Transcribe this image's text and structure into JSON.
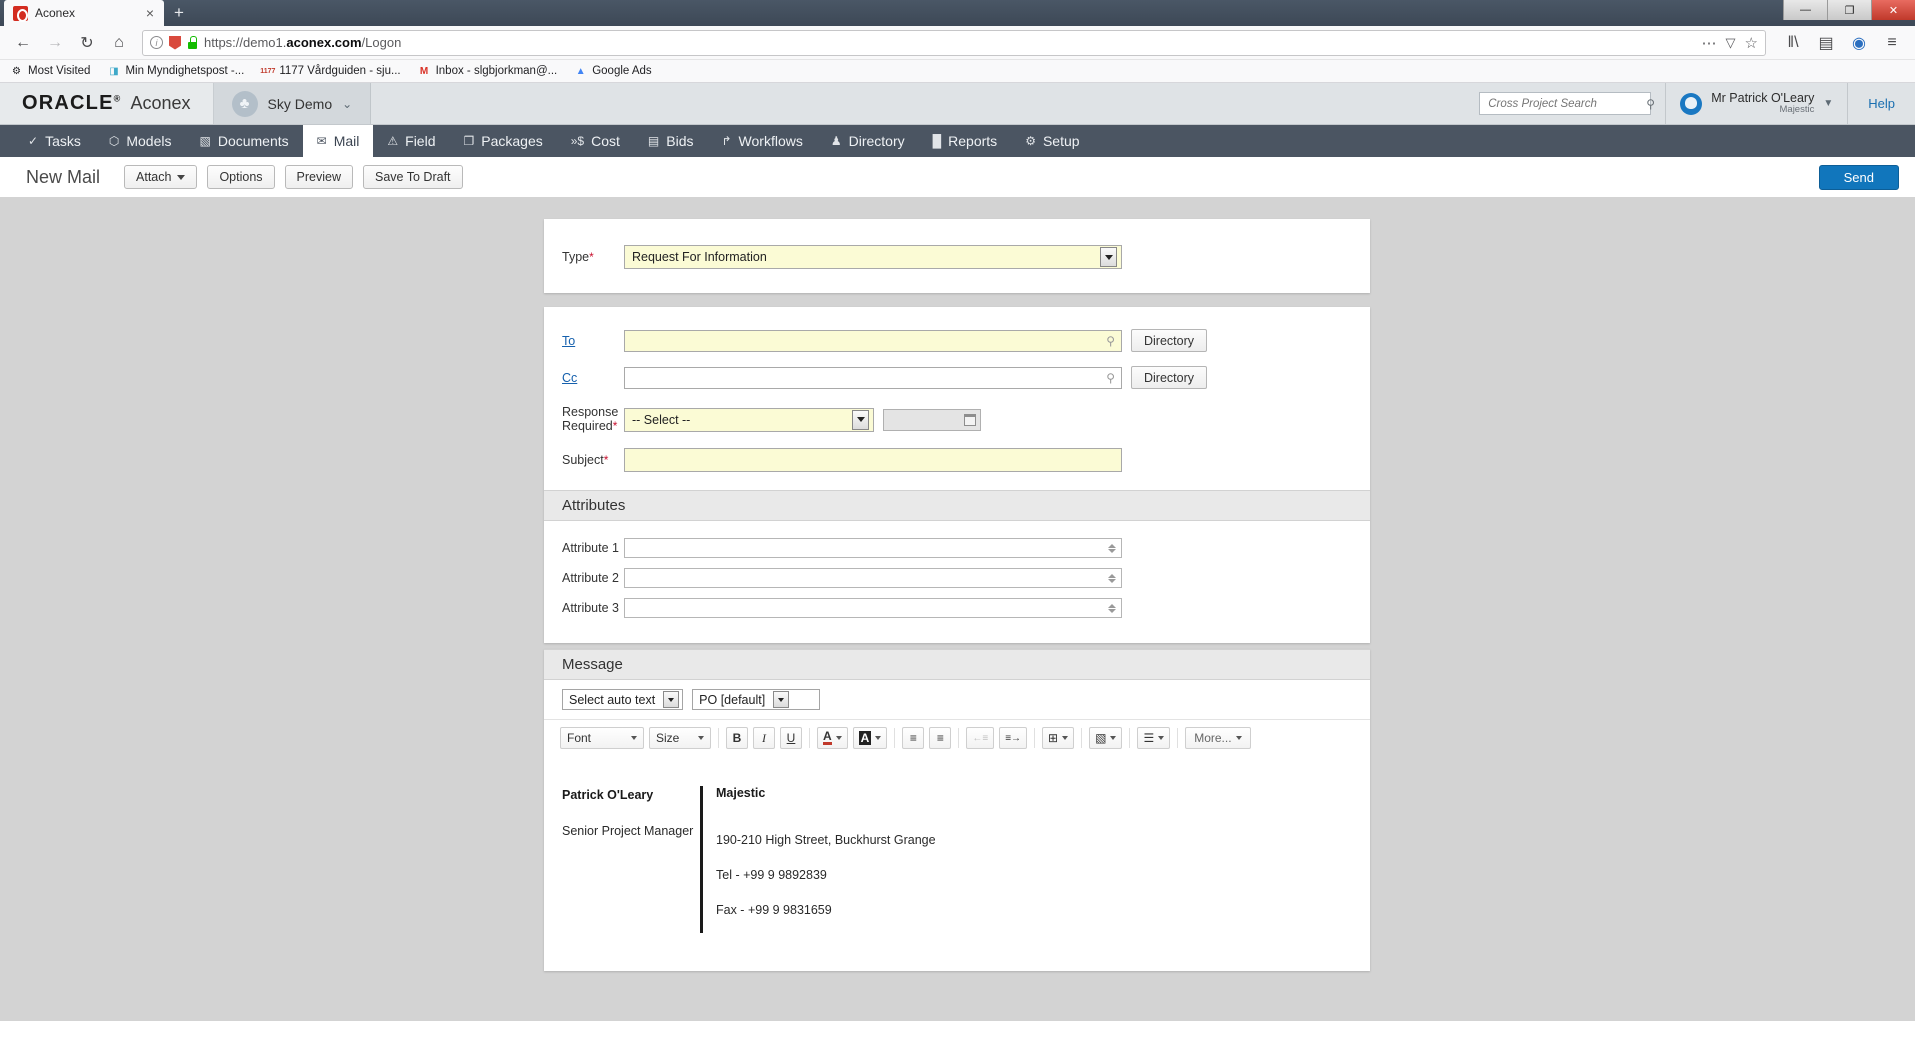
{
  "browser": {
    "tab_title": "Aconex",
    "tab_close": "×",
    "new_tab": "+",
    "win_minimize": "—",
    "win_restore": "❐",
    "win_close": "✕",
    "back_icon": "←",
    "forward_icon": "→",
    "reload_icon": "↻",
    "home_icon": "⌂",
    "info_icon": "i",
    "url_prefix": "https://demo1.",
    "url_bold": "aconex.com",
    "url_suffix": "/Logon",
    "page_actions_icon": "⋯",
    "pocket_icon": "▽",
    "bookmark_star_icon": "☆",
    "library_icon": "‖\\",
    "sidebar_icon": "▤",
    "account_icon": "◉",
    "menu_icon": "≡",
    "bookmarks": [
      {
        "label": "Most Visited",
        "icon": "⚙"
      },
      {
        "label": "Min Myndighetspost -...",
        "icon": "◨"
      },
      {
        "label": "1177 Vårdguiden - sju...",
        "icon": "1177"
      },
      {
        "label": "Inbox - slgbjorkman@...",
        "icon": "M"
      },
      {
        "label": "Google Ads",
        "icon": "▲"
      }
    ]
  },
  "app_header": {
    "brand_primary": "ORACLE",
    "brand_trademark": "®",
    "brand_secondary": "Aconex",
    "project_name": "Sky Demo",
    "project_caret": "⌄",
    "project_avatar_icon": "people-icon",
    "search_placeholder": "Cross Project Search",
    "search_value": "",
    "search_icon": "⚲",
    "user_name": "Mr Patrick O'Leary",
    "user_org": "Majestic",
    "user_caret": "▼",
    "help_label": "Help"
  },
  "nav_tabs": [
    {
      "label": "Tasks",
      "icon": "✓",
      "active": false
    },
    {
      "label": "Models",
      "icon": "⬡",
      "active": false
    },
    {
      "label": "Documents",
      "icon": "▧",
      "active": false
    },
    {
      "label": "Mail",
      "icon": "✉",
      "active": true
    },
    {
      "label": "Field",
      "icon": "⚠",
      "active": false
    },
    {
      "label": "Packages",
      "icon": "❐",
      "active": false
    },
    {
      "label": "Cost",
      "icon": "»$",
      "active": false
    },
    {
      "label": "Bids",
      "icon": "▤",
      "active": false
    },
    {
      "label": "Workflows",
      "icon": "↱",
      "active": false
    },
    {
      "label": "Directory",
      "icon": "♟",
      "active": false
    },
    {
      "label": "Reports",
      "icon": "█",
      "active": false
    },
    {
      "label": "Setup",
      "icon": "⚙",
      "active": false
    }
  ],
  "toolbar": {
    "page_title": "New Mail",
    "attach_label": "Attach",
    "options_label": "Options",
    "preview_label": "Preview",
    "save_draft_label": "Save To Draft",
    "send_label": "Send"
  },
  "form": {
    "type_label": "Type",
    "type_required": "*",
    "type_value": "Request For Information",
    "to_label": "To",
    "to_value": "",
    "to_directory_label": "Directory",
    "cc_label": "Cc",
    "cc_value": "",
    "cc_directory_label": "Directory",
    "response_label_line1": "Response",
    "response_label_line2": "Required",
    "response_required": "*",
    "response_value": "-- Select --",
    "response_date_value": "",
    "subject_label": "Subject",
    "subject_required": "*",
    "subject_value": ""
  },
  "attributes": {
    "section_title": "Attributes",
    "rows": [
      {
        "label": "Attribute 1",
        "value": ""
      },
      {
        "label": "Attribute 2",
        "value": ""
      },
      {
        "label": "Attribute 3",
        "value": ""
      }
    ]
  },
  "message": {
    "section_title": "Message",
    "autotext_value": "Select auto text",
    "template_value": "PO [default]",
    "rte": {
      "font_label": "Font",
      "size_label": "Size",
      "bold_label": "B",
      "italic_label": "I",
      "underline_label": "U",
      "text_color_label": "A",
      "highlight_label": "A",
      "numbered_list_icon": "≡",
      "bullet_list_icon": "≡",
      "outdent_icon": "←≡",
      "indent_icon": "≡→",
      "table_icon": "⊞",
      "paste_icon": "▧",
      "align_icon": "☰",
      "more_label": "More..."
    },
    "signature": {
      "name": "Patrick O'Leary",
      "role": "Senior Project Manager",
      "org": "Majestic",
      "address": "190-210 High Street, Buckhurst Grange",
      "tel": "Tel - +99 9 9892839",
      "fax": "Fax - +99 9 9831659"
    }
  },
  "colors": {
    "accent_blue": "#1176bc",
    "nav_dark": "#4b5562",
    "required_red": "#c8102e",
    "field_yellow": "#fbfbd5",
    "content_gray": "#d3d3d3"
  }
}
